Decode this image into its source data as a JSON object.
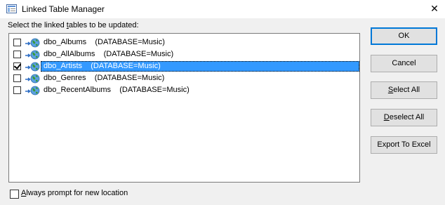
{
  "window": {
    "title": "Linked Table Manager",
    "close_glyph": "✕"
  },
  "instruction": "Select the linked tables to be updated:",
  "tables": [
    {
      "name": "dbo_Albums",
      "source": "(DATABASE=Music)",
      "checked": false,
      "selected": false
    },
    {
      "name": "dbo_AllAlbums",
      "source": "(DATABASE=Music)",
      "checked": false,
      "selected": false
    },
    {
      "name": "dbo_Artists",
      "source": "(DATABASE=Music)",
      "checked": true,
      "selected": true
    },
    {
      "name": "dbo_Genres",
      "source": "(DATABASE=Music)",
      "checked": false,
      "selected": false
    },
    {
      "name": "dbo_RecentAlbums",
      "source": "(DATABASE=Music)",
      "checked": false,
      "selected": false
    }
  ],
  "buttons": {
    "ok": "OK",
    "cancel": "Cancel",
    "select_all": "Select All",
    "deselect_all": "Deselect All",
    "export_to_excel": "Export To Excel"
  },
  "footer": {
    "always_prompt_label": "Always prompt for new location",
    "always_prompt_checked": false
  },
  "colors": {
    "selection": "#3399ff",
    "default_button_border": "#0078d7",
    "globe": "#3a9a3a",
    "arrow": "#2b6cc4"
  },
  "icons": {
    "app": "linked-table-manager-icon",
    "row": "linked-table-globe-icon"
  }
}
